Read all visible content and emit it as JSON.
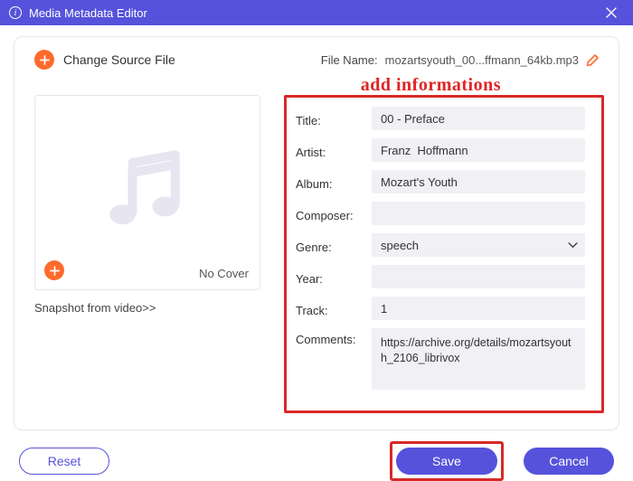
{
  "window": {
    "title": "Media Metadata Editor"
  },
  "top": {
    "change_source": "Change Source File",
    "file_name_label": "File Name:",
    "file_name_value": "mozartsyouth_00...ffmann_64kb.mp3"
  },
  "annotation": "add informations",
  "cover": {
    "no_cover": "No Cover",
    "snapshot": "Snapshot from video>>"
  },
  "form": {
    "labels": {
      "title": "Title:",
      "artist": "Artist:",
      "album": "Album:",
      "composer": "Composer:",
      "genre": "Genre:",
      "year": "Year:",
      "track": "Track:",
      "comments": "Comments:"
    },
    "values": {
      "title": "00 - Preface",
      "artist": "Franz  Hoffmann",
      "album": "Mozart's Youth",
      "composer": "",
      "genre": "speech",
      "year": "",
      "track": "1",
      "comments": "https://archive.org/details/mozartsyouth_2106_librivox"
    }
  },
  "footer": {
    "reset": "Reset",
    "save": "Save",
    "cancel": "Cancel"
  }
}
